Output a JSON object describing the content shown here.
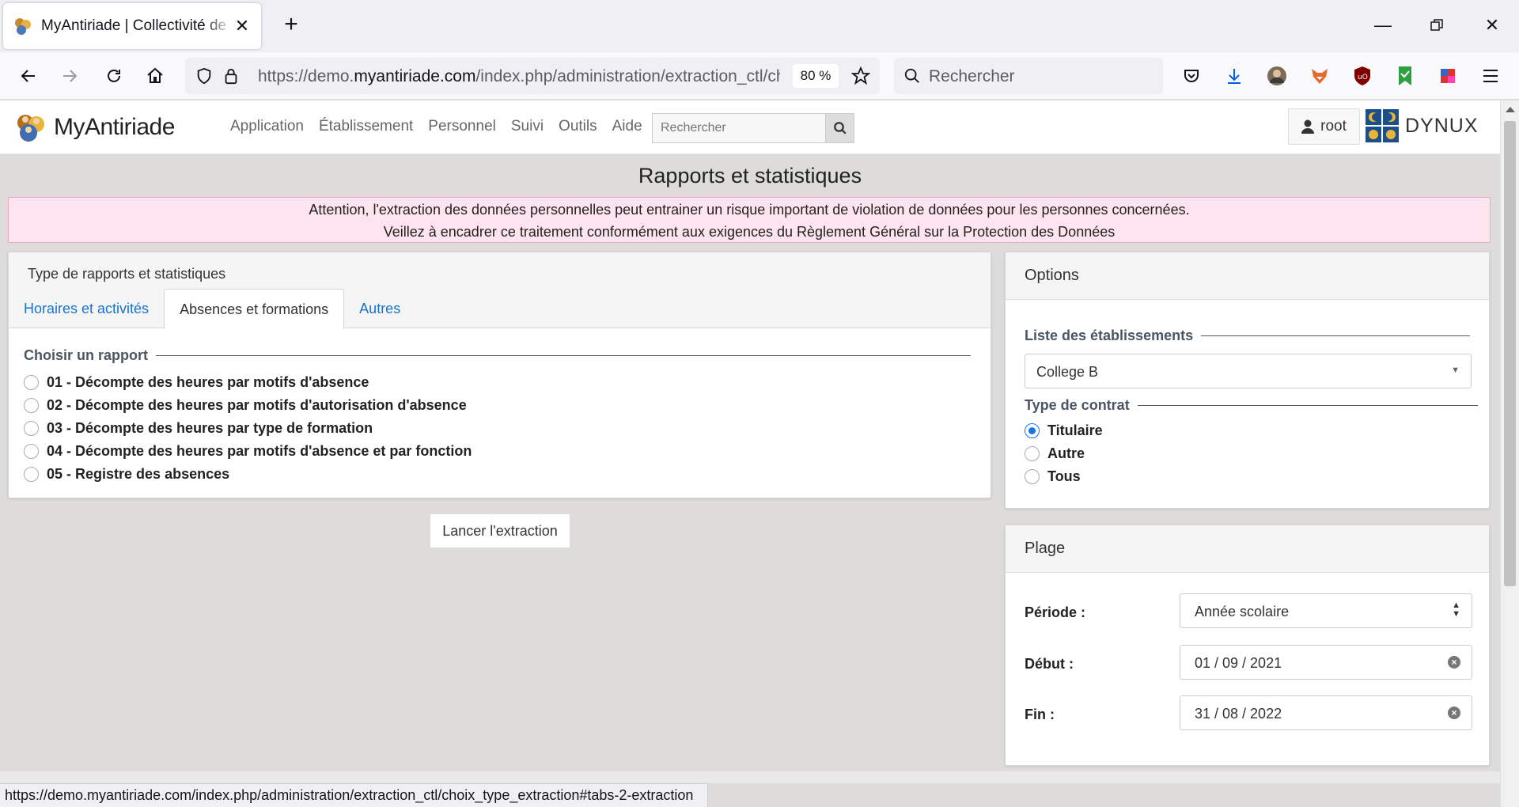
{
  "browser": {
    "tab_title": "MyAntiriade | Collectivité de démonstration",
    "url_prefix": "https://demo.",
    "url_domain": "myantiriade.com",
    "url_path": "/index.php/administration/extraction_ctl/choix_type_extraction",
    "zoom": "80 %",
    "search_placeholder": "Rechercher",
    "status_url": "https://demo.myantiriade.com/index.php/administration/extraction_ctl/choix_type_extraction#tabs-2-extraction"
  },
  "header": {
    "logo_text": "MyAntiriade",
    "menu": [
      "Application",
      "Établissement",
      "Personnel",
      "Suivi",
      "Outils",
      "Aide"
    ],
    "search_placeholder": "Rechercher",
    "user": "root",
    "brand": "DYNUX"
  },
  "page": {
    "title": "Rapports et statistiques",
    "warning_line1": "Attention, l'extraction des données personnelles peut entrainer un risque important de violation de données pour les personnes concernées.",
    "warning_line2": "Veillez à encadrer ce traitement conformément aux exigences du Règlement Général sur la Protection des Données"
  },
  "reports": {
    "section_title": "Type de rapports et statistiques",
    "tabs": [
      "Horaires et activités",
      "Absences et formations",
      "Autres"
    ],
    "active_tab": "Absences et formations",
    "legend": "Choisir un rapport",
    "items": [
      "01 - Décompte des heures par motifs d'absence",
      "02 - Décompte des heures par motifs d'autorisation d'absence",
      "03 - Décompte des heures par type de formation",
      "04 - Décompte des heures par motifs d'absence et par fonction",
      "05 - Registre des absences"
    ],
    "launch_button": "Lancer l'extraction"
  },
  "options": {
    "title": "Options",
    "etab_legend": "Liste des établissements",
    "etab_value": "College B",
    "contract_legend": "Type de contrat",
    "contracts": [
      "Titulaire",
      "Autre",
      "Tous"
    ],
    "contract_selected": "Titulaire"
  },
  "plage": {
    "title": "Plage",
    "periode_label": "Période :",
    "periode_value": "Année scolaire",
    "debut_label": "Début :",
    "debut_value": "01 / 09 / 2021",
    "fin_label": "Fin :",
    "fin_value": "31 / 08 / 2022"
  },
  "colors": {
    "link": "#1a73c9",
    "warning_bg": "#fde4ee",
    "warning_border": "#f2a7c3",
    "radio_checked": "#1a73e8"
  }
}
